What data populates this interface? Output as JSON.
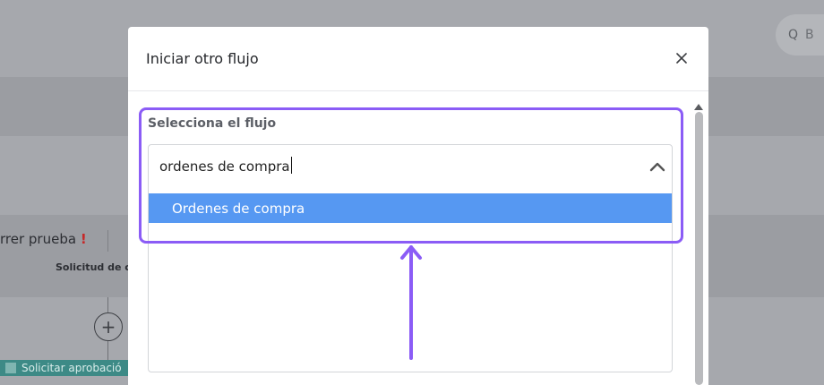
{
  "background": {
    "search_partial": "Q",
    "search_partial_rest": "B",
    "partial_label": "rrer prueba",
    "partial_label_mark": "!",
    "partial_column": "Solicitud de c",
    "plus_glyph": "+",
    "green_strip": "Solicitar aprobació"
  },
  "modal": {
    "title": "Iniciar otro flujo",
    "close_icon": "close-icon",
    "field_label": "Selecciona el flujo",
    "select": {
      "input_value": "ordenes de compra",
      "toggle_icon": "chevron-up-icon",
      "options": [
        {
          "label": "Ordenes de compra",
          "highlighted": true
        }
      ]
    }
  },
  "annotation": {
    "highlight_color": "#8b5cf6",
    "arrow_icon": "arrow-up-icon"
  },
  "colors": {
    "option_highlight": "#5698f2",
    "overlay": "#a6a8ad"
  }
}
